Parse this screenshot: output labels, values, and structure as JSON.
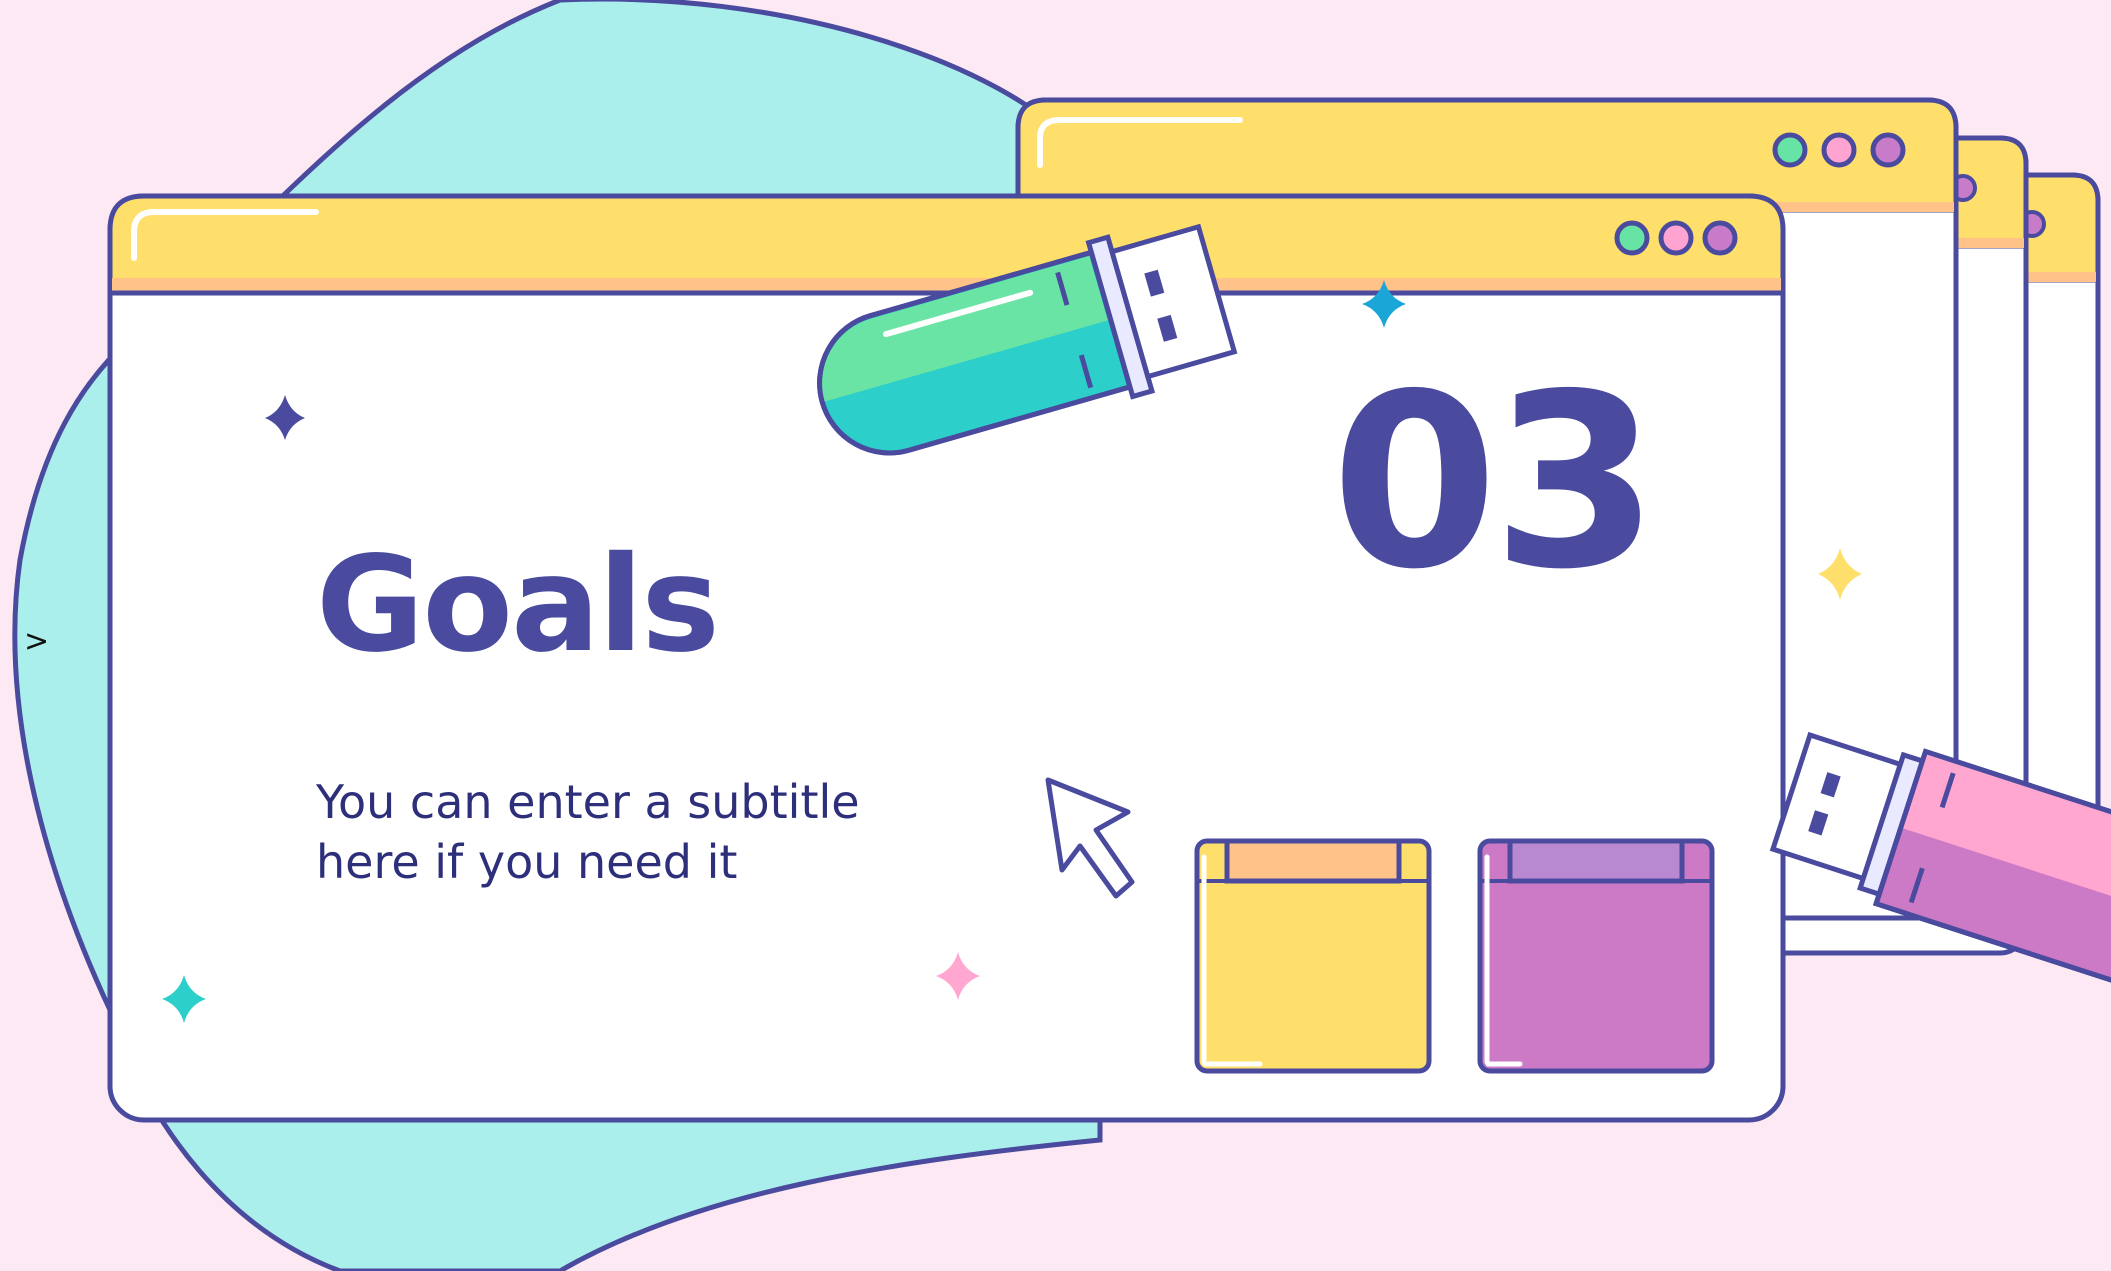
{
  "slide": {
    "number": "03",
    "title": "Goals",
    "subtitle_line1": "You can enter a subtitle",
    "subtitle_line2": "here if you need it",
    "side_marker": ">"
  },
  "icons": {
    "usb_drive_teal": "usb-drive-icon",
    "usb_drive_pink": "usb-drive-icon",
    "cursor": "mouse-pointer-icon",
    "sparkles": "sparkle-icon",
    "folders": "folder-icon",
    "window_dots": "window-control-dot-icon"
  },
  "colors": {
    "background": "#fde9f3",
    "blob": "#abefec",
    "outline": "#4a4b9e",
    "title_bar": "#ffdf6b",
    "title_bar_stripe": "#ffc38a",
    "window_body": "#ffffff",
    "dot_green": "#66e3a5",
    "dot_pink": "#ffa3d1",
    "dot_purple": "#c77bc9",
    "usb_green": "#6ae4a4",
    "usb_teal": "#2ccfca",
    "usb_pink": "#ffa7d1",
    "usb_magenta": "#cc7ac5",
    "folder_yellow": "#ffdf6b",
    "folder_yellow_tab": "#ffc38a",
    "folder_purple": "#cc7ac5",
    "folder_purple_tab": "#b889d0",
    "sparkle_navy": "#4a4b9e",
    "sparkle_teal": "#2ccfca",
    "sparkle_blue": "#1aa7d8",
    "sparkle_pink": "#ffa7d1",
    "sparkle_yellow": "#ffdf6b"
  }
}
